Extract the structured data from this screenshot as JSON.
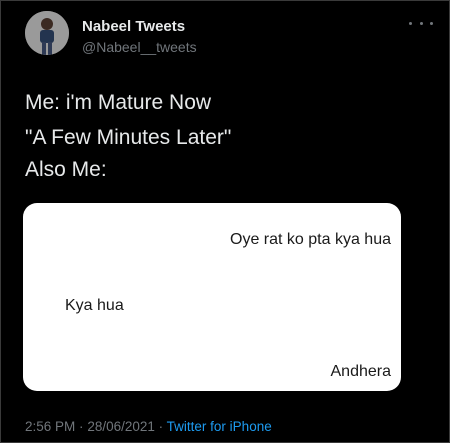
{
  "author": {
    "name": "Nabeel Tweets",
    "handle": "@Nabeel__tweets"
  },
  "more_icon": "more-horizontal-icon",
  "tweet": {
    "lines": [
      "Me: i'm Mature Now",
      "\"A Few Minutes Later\"",
      "Also Me:"
    ]
  },
  "card": {
    "messages": [
      "Oye rat ko pta kya hua",
      "Kya hua",
      "Andhera"
    ]
  },
  "footer": {
    "time": "2:56 PM",
    "separator": "·",
    "date": "28/06/2021",
    "source": "Twitter for iPhone"
  },
  "colors": {
    "background": "#000000",
    "text_primary": "#e7e9ea",
    "text_secondary": "#71767b",
    "link": "#1d9bf0",
    "card_background": "#ffffff"
  }
}
